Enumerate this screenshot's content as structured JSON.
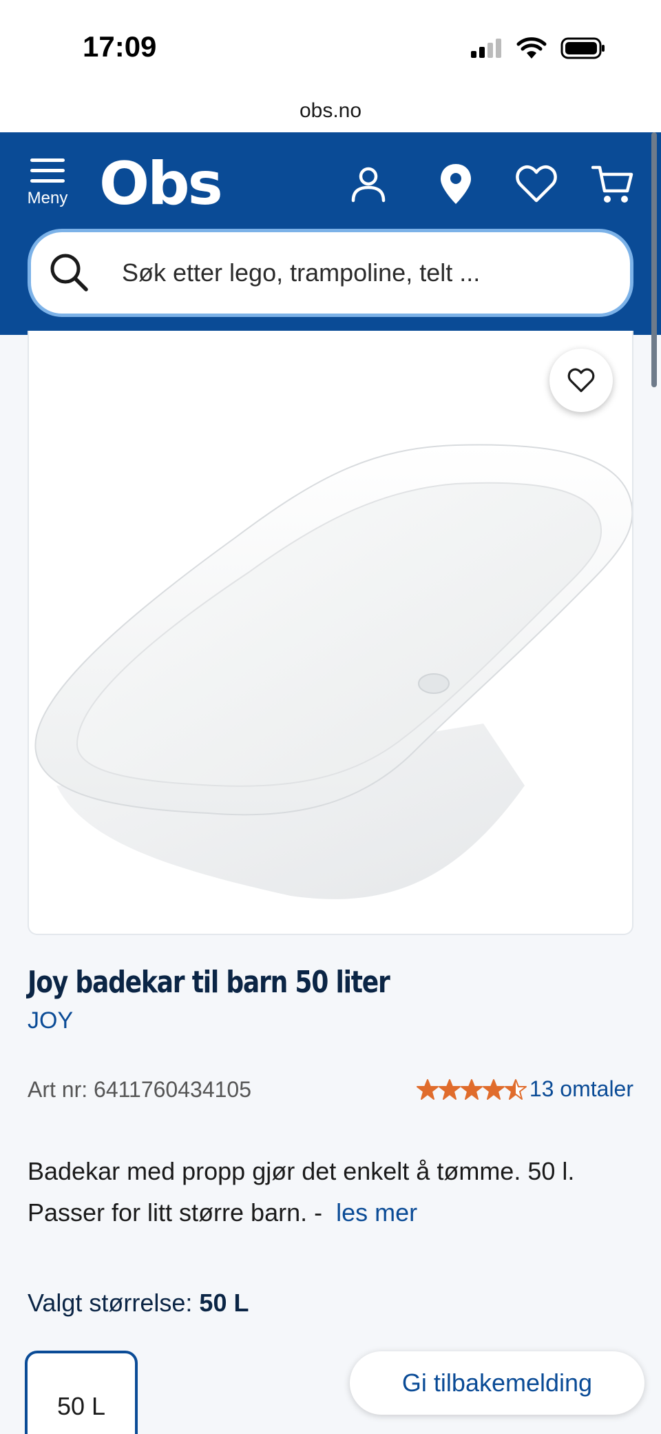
{
  "status_bar": {
    "time": "17:09",
    "icons": [
      "cellular-signal-icon",
      "wifi-icon",
      "battery-icon"
    ]
  },
  "browser": {
    "url": "obs.no"
  },
  "header": {
    "menu_label": "Meny",
    "logo_text": "Obs",
    "icons": [
      "account-icon",
      "store-location-icon",
      "favorites-heart-icon",
      "cart-icon"
    ],
    "brand_color": "#0a4b96"
  },
  "search": {
    "placeholder": "Søk etter lego, trampoline, telt ..."
  },
  "product": {
    "image_alt": "Joy badekar til barn 50 liter",
    "title": "Joy badekar til barn 50 liter",
    "brand": "JOY",
    "art_nr": "Art nr: 6411760434105",
    "rating_value": 4.5,
    "rating_max": 5,
    "reviews_text": "13 omtaler",
    "description": "Badekar med propp gjør det enkelt å tømme. 50 l. Passer for litt større barn. -",
    "read_more": "les mer",
    "size_label_prefix": "Valgt størrelse:",
    "size_selected": "50 L",
    "size_options": [
      "50 L"
    ],
    "feedback_button": "Gi tilbakemelding",
    "star_color": "#e06c2c"
  }
}
